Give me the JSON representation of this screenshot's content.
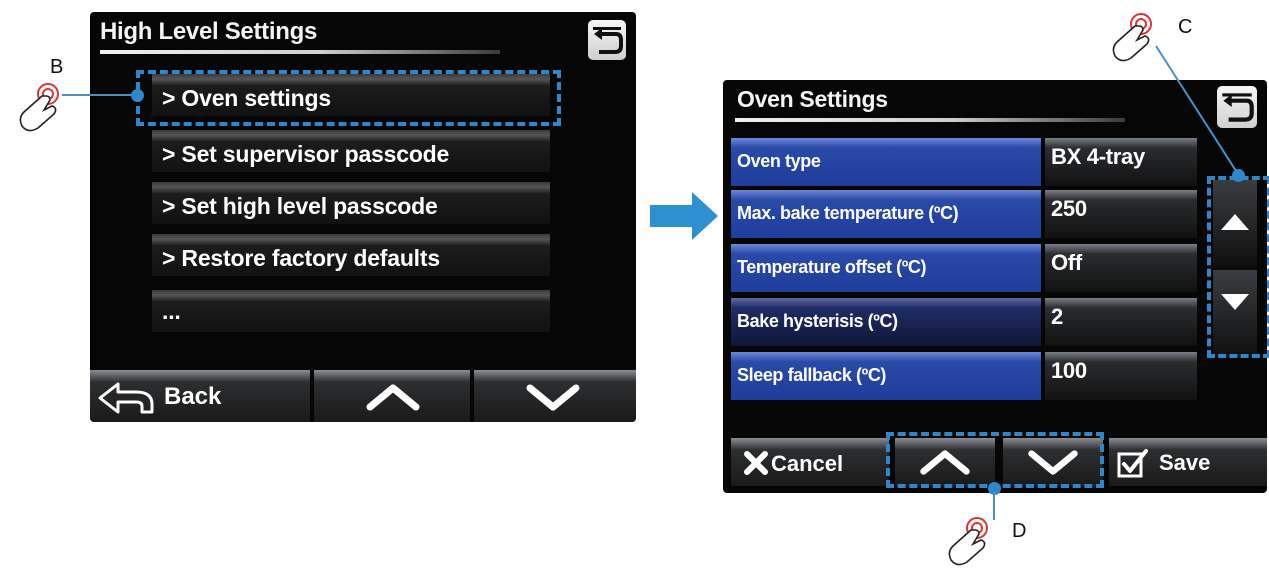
{
  "screen_high_level": {
    "title": "High Level Settings",
    "return_icon": "return-arrow-icon",
    "menu": [
      {
        "label": "> Oven settings"
      },
      {
        "label": "> Set supervisor passcode"
      },
      {
        "label": "> Set high level passcode"
      },
      {
        "label": "> Restore factory defaults"
      },
      {
        "label": "..."
      }
    ],
    "bottom": {
      "back_label": "Back",
      "back_icon": "back-arrow-icon",
      "up_icon": "chevron-up-icon",
      "down_icon": "chevron-down-icon"
    }
  },
  "screen_oven": {
    "title": "Oven Settings",
    "return_icon": "return-arrow-icon",
    "rows": [
      {
        "label": "Oven type",
        "value": "BX 4-tray"
      },
      {
        "label": "Max. bake temperature (ºC)",
        "value": "250"
      },
      {
        "label": "Temperature offset (ºC)",
        "value": "Off"
      },
      {
        "label": "Bake hysterisis (ºC)",
        "value": "2"
      },
      {
        "label": "Sleep fallback (ºC)",
        "value": "100"
      }
    ],
    "bottom": {
      "cancel_label": "Cancel",
      "save_label": "Save"
    }
  },
  "callouts": {
    "b": "B",
    "c": "C",
    "d": "D"
  },
  "colors": {
    "accent_blue": "#2f86c8",
    "row_blue": "#1f3d9a"
  }
}
